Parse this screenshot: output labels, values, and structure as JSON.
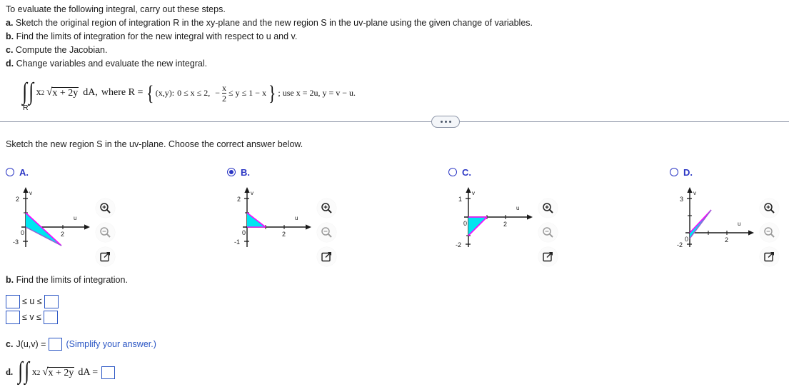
{
  "prompt": {
    "intro": "To evaluate the following integral, carry out these steps.",
    "steps": [
      {
        "tag": "a.",
        "text": "Sketch the original region of integration R in the xy-plane and the new region S in the uv-plane using the given change of variables."
      },
      {
        "tag": "b.",
        "text": "Find the limits of integration for the new integral with respect to u and v."
      },
      {
        "tag": "c.",
        "text": "Compute the Jacobian."
      },
      {
        "tag": "d.",
        "text": "Change variables and evaluate the new integral."
      }
    ],
    "integral": {
      "integrand_base": "x",
      "integrand_exp": "2",
      "radicand": "x + 2y",
      "differential": "dA,",
      "where": "where R =",
      "set_open": "(x,y):",
      "x_bounds": "0 ≤ x ≤ 2,",
      "minus": "−",
      "frac_num": "x",
      "frac_den": "2",
      "y_bounds": "≤ y ≤ 1 − x",
      "tail": "; use x = 2u, y = v − u.",
      "lower_label": "R"
    }
  },
  "divider": {
    "dots_label": "•••"
  },
  "question": "Sketch the new region S in the uv-plane. Choose the correct answer below.",
  "icon_buttons": [
    {
      "name": "zoom-in-icon",
      "label": "Zoom in"
    },
    {
      "name": "zoom-out-icon",
      "label": "Zoom out"
    },
    {
      "name": "expand-icon",
      "label": "Open in new window"
    }
  ],
  "choices": [
    {
      "letter": "A.",
      "selected": false,
      "axis": {
        "u_label": "u",
        "v_label": "v",
        "origin_label": "0",
        "u_tick": "2",
        "v_top": "2",
        "v_bottom": "-3"
      },
      "shape": "thin-triangle-down-right"
    },
    {
      "letter": "B.",
      "selected": true,
      "axis": {
        "u_label": "u",
        "v_label": "v",
        "origin_label": "0",
        "u_tick": "2",
        "v_top": "2",
        "v_bottom": "-1"
      },
      "shape": "triangle-0-0__0-1__1-0"
    },
    {
      "letter": "C.",
      "selected": false,
      "axis": {
        "u_label": "u",
        "v_label": "v",
        "origin_label": "0",
        "u_tick": "2",
        "v_top": "1",
        "v_bottom": "-2"
      },
      "shape": "triangle-0-0__1-0__0-neg1"
    },
    {
      "letter": "D.",
      "selected": false,
      "axis": {
        "u_label": "u",
        "v_label": "v",
        "origin_label": "0",
        "u_tick": "2",
        "v_top": "3",
        "v_bottom": "-2"
      },
      "shape": "thin-triangle-up-right"
    }
  ],
  "part_b": {
    "heading_tag": "b.",
    "heading_text": "Find the limits of integration.",
    "row1": {
      "left_value": "",
      "relation": "≤ u ≤",
      "right_value": ""
    },
    "row2": {
      "left_value": "",
      "relation": "≤ v ≤",
      "right_value": ""
    }
  },
  "part_c": {
    "heading_tag": "c.",
    "label": "J(u,v) =",
    "value": "",
    "note": "(Simplify your answer.)"
  },
  "part_d": {
    "heading_tag": "d.",
    "integrand_base": "x",
    "integrand_exp": "2",
    "radicand": "x + 2y",
    "differential": "dA =",
    "value": ""
  },
  "colors": {
    "fill": "#00e5f0",
    "edge": "#ff00ff",
    "axis": "#1a1a1a",
    "accent_blue": "#2b36c4",
    "input_border": "#2b56c4",
    "divider": "#8e96a8"
  }
}
